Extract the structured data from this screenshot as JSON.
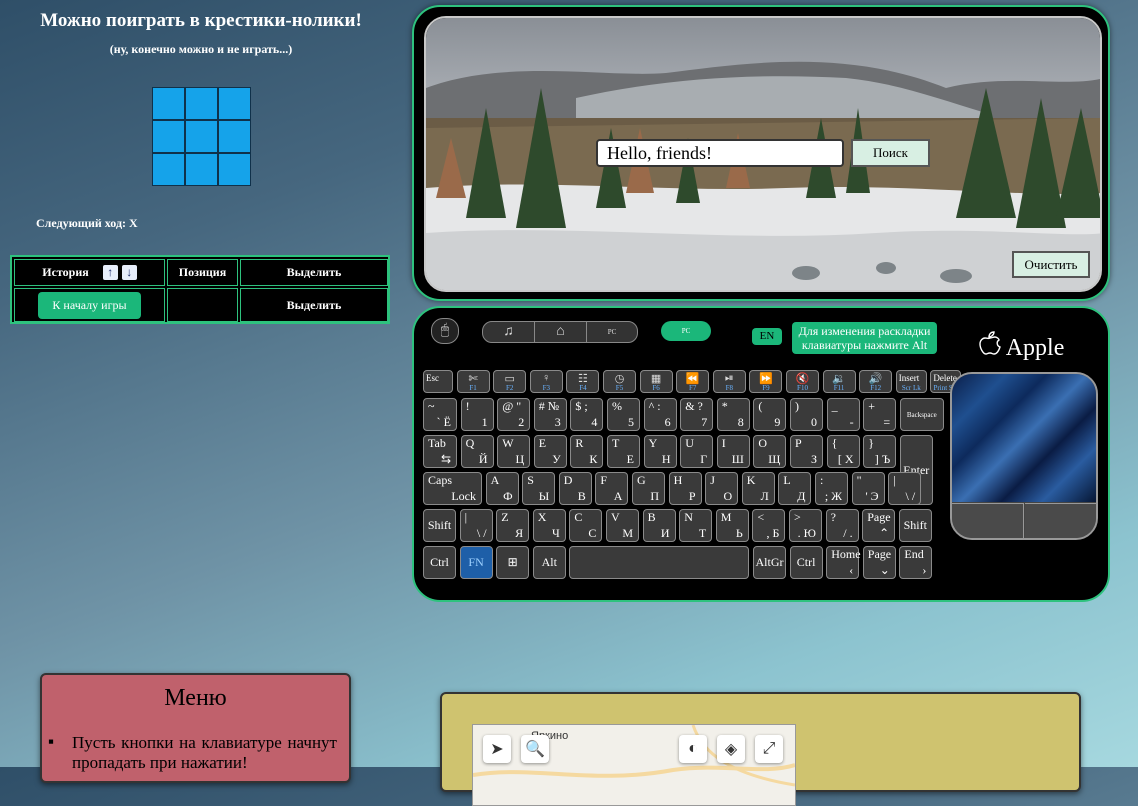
{
  "game": {
    "title": "Можно поиграть в крестики-нолики!",
    "subtitle": "(ну, конечно можно и не играть...)",
    "board": [
      "",
      "",
      "",
      "",
      "",
      "",
      "",
      "",
      ""
    ],
    "next_move": "Следующий ход: X",
    "history": {
      "col_history": "История",
      "col_position": "Позиция",
      "col_select": "Выделить",
      "up_icon": "arrow-up-icon",
      "down_icon": "arrow-down-icon",
      "rows": [
        {
          "action": "К началу игры",
          "position": "",
          "select": "Выделить"
        }
      ]
    }
  },
  "search": {
    "value": "Hello, friends!",
    "button": "Поиск",
    "clear_button": "Очистить"
  },
  "keyboard": {
    "brand": "Apple",
    "layout_badge": "EN",
    "layout_hint": "Для изменения раскладки клавиатуры нажмите Alt",
    "mode_buttons": [
      "music-icon",
      "home-icon",
      "PC"
    ],
    "mode_active": "PC",
    "rows": [
      [
        {
          "t": "Esc"
        },
        {
          "f": "F1",
          "i": "✄"
        },
        {
          "f": "F2",
          "i": "▭"
        },
        {
          "f": "F3",
          "i": "♀"
        },
        {
          "f": "F4",
          "i": "☷"
        },
        {
          "f": "F5",
          "i": "◷"
        },
        {
          "f": "F6",
          "i": "▦"
        },
        {
          "f": "F7",
          "i": "⏪"
        },
        {
          "f": "F8",
          "i": "⏯"
        },
        {
          "f": "F9",
          "i": "⏩"
        },
        {
          "f": "F10",
          "i": "🔇"
        },
        {
          "f": "F11",
          "i": "🔉"
        },
        {
          "f": "F12",
          "i": "🔊"
        },
        {
          "t": "Insert",
          "f": "Scr Lk"
        },
        {
          "t": "Delete",
          "f": "Print Scr"
        }
      ],
      [
        {
          "t": "~",
          "b": "` Ё"
        },
        {
          "t": "!",
          "b": "1"
        },
        {
          "t": "@ \"",
          "b": "2"
        },
        {
          "t": "# №",
          "b": "3"
        },
        {
          "t": "$ ;",
          "b": "4"
        },
        {
          "t": "% ",
          "b": "5"
        },
        {
          "t": "^ :",
          "b": "6"
        },
        {
          "t": "& ?",
          "b": "7"
        },
        {
          "t": "*",
          "b": "8"
        },
        {
          "t": "(",
          "b": "9"
        },
        {
          "t": ")",
          "b": "0"
        },
        {
          "t": "_",
          "b": "-"
        },
        {
          "t": "+",
          "b": "="
        },
        {
          "c": "Backspace"
        }
      ],
      [
        {
          "t": "Tab",
          "b": "⇆"
        },
        {
          "t": "Q",
          "b": "Й"
        },
        {
          "t": "W",
          "b": "Ц"
        },
        {
          "t": "E",
          "b": "У"
        },
        {
          "t": "R",
          "b": "К"
        },
        {
          "t": "T",
          "b": "Е"
        },
        {
          "t": "Y",
          "b": "Н"
        },
        {
          "t": "U",
          "b": "Г"
        },
        {
          "t": "I",
          "b": "Ш"
        },
        {
          "t": "O",
          "b": "Щ"
        },
        {
          "t": "P",
          "b": "З"
        },
        {
          "t": "{",
          "b": "[ Х"
        },
        {
          "t": "}",
          "b": "] Ъ"
        },
        {
          "c": "Enter"
        }
      ],
      [
        {
          "t": "Caps",
          "b": "Lock"
        },
        {
          "t": "A",
          "b": "Ф"
        },
        {
          "t": "S",
          "b": "Ы"
        },
        {
          "t": "D",
          "b": "В"
        },
        {
          "t": "F",
          "b": "А"
        },
        {
          "t": "G",
          "b": "П"
        },
        {
          "t": "H",
          "b": "Р"
        },
        {
          "t": "J",
          "b": "О"
        },
        {
          "t": "K",
          "b": "Л"
        },
        {
          "t": "L",
          "b": "Д"
        },
        {
          "t": ":",
          "b": "; Ж"
        },
        {
          "t": "\"",
          "b": "' Э"
        },
        {
          "t": "|",
          "b": "\\ /"
        }
      ],
      [
        {
          "c": "Shift"
        },
        {
          "t": "|",
          "b": "\\ /"
        },
        {
          "t": "Z",
          "b": "Я"
        },
        {
          "t": "X",
          "b": "Ч"
        },
        {
          "t": "C",
          "b": "С"
        },
        {
          "t": "V",
          "b": "М"
        },
        {
          "t": "B",
          "b": "И"
        },
        {
          "t": "N",
          "b": "Т"
        },
        {
          "t": "M",
          "b": "Ь"
        },
        {
          "t": "<",
          "b": ", Б"
        },
        {
          "t": ">",
          "b": ". Ю"
        },
        {
          "t": "?",
          "b": "/ ."
        },
        {
          "t": "Page",
          "b": "⌃"
        },
        {
          "c": "Shift"
        }
      ],
      [
        {
          "c": "Ctrl"
        },
        {
          "c": "FN"
        },
        {
          "c": "⊞"
        },
        {
          "c": "Alt"
        },
        {
          "c": ""
        },
        {
          "c": "AltGr"
        },
        {
          "c": "Ctrl"
        },
        {
          "t": "Home",
          "b": "‹"
        },
        {
          "t": "Page",
          "b": "⌄"
        },
        {
          "t": "End",
          "b": "›"
        }
      ]
    ]
  },
  "menu": {
    "title": "Меню",
    "items": [
      "Пусть кнопки на клавиатуре начнут пропадать при нажатии!"
    ]
  },
  "map": {
    "place_label": "Яркино",
    "tools": [
      "navigate-icon",
      "search-icon",
      "traffic-icon",
      "layers-icon",
      "fullscreen-icon"
    ]
  },
  "colors": {
    "accent": "#2ec27e",
    "cell": "#15a3ea",
    "menu_bg": "#c0616c",
    "map_panel": "#cfc36f"
  }
}
